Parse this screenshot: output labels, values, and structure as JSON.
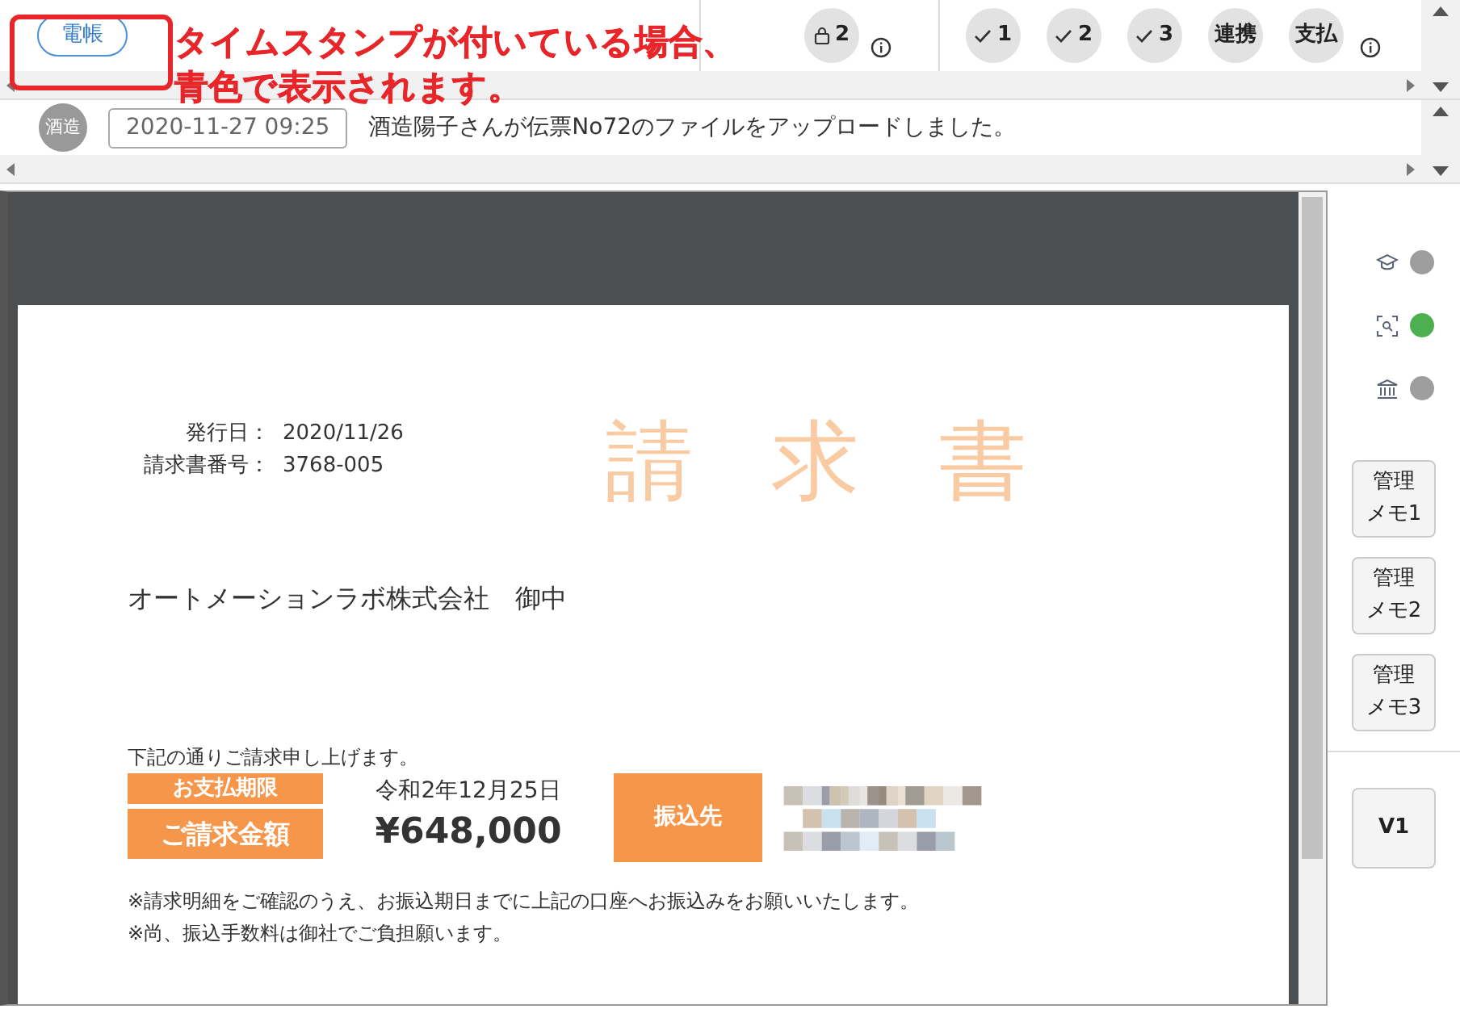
{
  "header": {
    "stamp": {
      "label": "電帳",
      "selected": true
    },
    "lock_count": "2",
    "checks": [
      {
        "label": "1",
        "checked": true
      },
      {
        "label": "2",
        "checked": true
      },
      {
        "label": "3",
        "checked": true
      }
    ],
    "actions": [
      "連携",
      "支払"
    ]
  },
  "annotation": {
    "lines": [
      "タイムスタンプが付いている場合、",
      "青色で表示されます。"
    ]
  },
  "activity": {
    "avatar": "酒造",
    "timestamp": "2020-11-27 09:25",
    "message": "酒造陽子さんが伝票No72のファイルをアップロードしました。"
  },
  "document": {
    "issue_date_label": "発行日：",
    "issue_date": "2020/11/26",
    "invoice_no_label": "請求書番号：",
    "invoice_no": "3768-005",
    "title": "請 求 書",
    "recipient": "オートメーションラボ株式会社　御中",
    "intro": "下記の通りご請求申し上げます。",
    "due_label": "お支払期限",
    "due": "令和2年12月25日",
    "amount_label": "ご請求金額",
    "amount": "¥648,000",
    "bank_label": "振込先",
    "notes": [
      "※請求明細をご確認のうえ、お振込期日までに上記の口座へお振込みをお願いいたします。",
      "※尚、振込手数料は御社でご負担願います。"
    ]
  },
  "sidebar": {
    "statuses": [
      {
        "kind": "school",
        "color": "#9e9e9e"
      },
      {
        "kind": "scan",
        "color": "#4caf50"
      },
      {
        "kind": "bank",
        "color": "#9e9e9e"
      }
    ],
    "memos": [
      {
        "lines": [
          "管理",
          "メモ1"
        ]
      },
      {
        "lines": [
          "管理",
          "メモ2"
        ]
      },
      {
        "lines": [
          "管理",
          "メモ3"
        ]
      }
    ],
    "version": "V1"
  }
}
